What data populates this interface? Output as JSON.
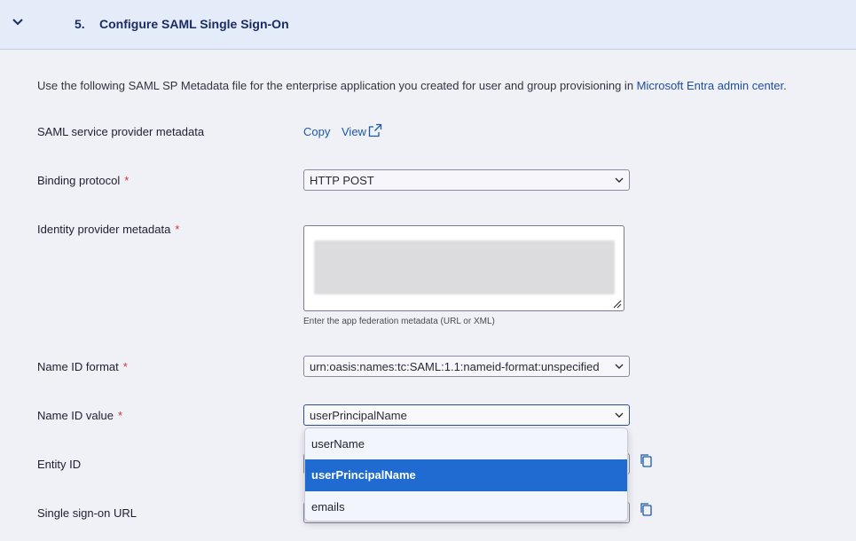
{
  "section": {
    "number": "5.",
    "title": "Configure SAML Single Sign-On",
    "icon": "chevron-down-icon"
  },
  "intro": {
    "text": "Use the following SAML SP Metadata file for the enterprise application you created for user and group provisioning in ",
    "link": "Microsoft Entra admin center",
    "end": "."
  },
  "fields": {
    "sp_metadata": {
      "label": "SAML service provider metadata",
      "copy": "Copy",
      "view": "View"
    },
    "binding": {
      "label": "Binding protocol",
      "required": "*",
      "value": "HTTP POST"
    },
    "idp_metadata": {
      "label": "Identity provider metadata",
      "required": "*",
      "helper": "Enter the app federation metadata (URL or XML)"
    },
    "nameid_format": {
      "label": "Name ID format",
      "required": "*",
      "value": "urn:oasis:names:tc:SAML:1.1:nameid-format:unspecified"
    },
    "nameid_value": {
      "label": "Name ID value",
      "required": "*",
      "value": "userPrincipalName"
    },
    "entity_id": {
      "label": "Entity ID"
    },
    "sso_url": {
      "label": "Single sign-on URL"
    }
  },
  "dropdown": {
    "options": [
      "userName",
      "userPrincipalName",
      "emails"
    ],
    "selected": "userPrincipalName"
  },
  "colors": {
    "header_bg": "#e4ecfa",
    "page_bg": "#f0f0f7",
    "accent": "#1f6bd1",
    "required": "#d13438",
    "link": "#1c5aa6"
  }
}
